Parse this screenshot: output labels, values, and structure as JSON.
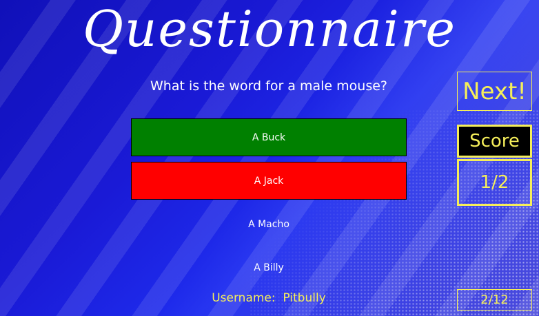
{
  "app": {
    "title": "Questionnaire"
  },
  "question": {
    "text": "What is the word for a male mouse?"
  },
  "answers": [
    {
      "label": "A Buck",
      "state": "correct",
      "color": "#008000"
    },
    {
      "label": "A Jack",
      "state": "wrong",
      "color": "#ff0000"
    },
    {
      "label": "A Macho",
      "state": "neutral"
    },
    {
      "label": "A Billy",
      "state": "neutral"
    }
  ],
  "controls": {
    "next_label": "Next!"
  },
  "score": {
    "label": "Score",
    "value": "1/2"
  },
  "user": {
    "username_text": "Username:  Pitbully"
  },
  "progress": {
    "text": "2/12"
  },
  "colors": {
    "accent": "#f5ee5a",
    "background": "#1a1ad6"
  }
}
